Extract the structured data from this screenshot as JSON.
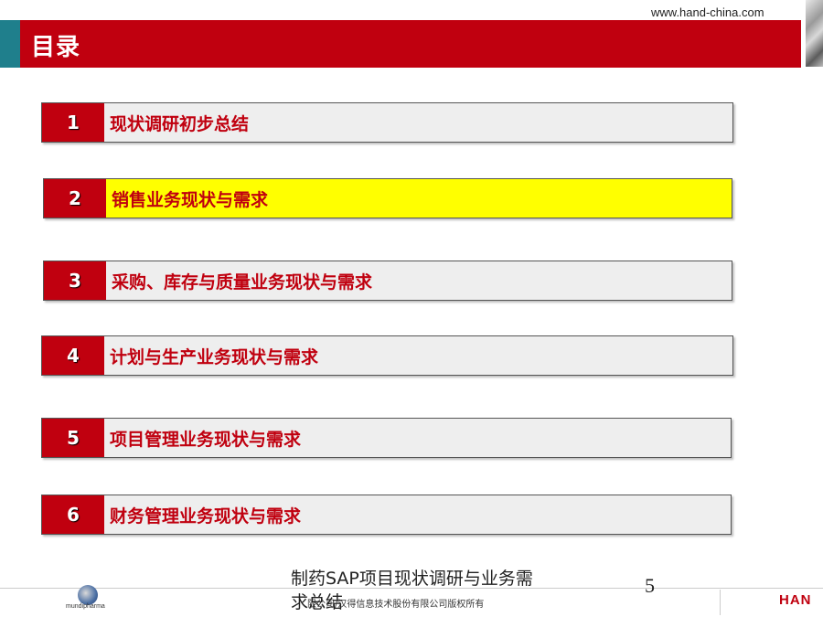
{
  "header": {
    "website": "www.hand-china.com",
    "title": "目录"
  },
  "toc": [
    {
      "number": "1",
      "label": "现状调研初步总结",
      "highlighted": false
    },
    {
      "number": "2",
      "label": "销售业务现状与需求",
      "highlighted": true
    },
    {
      "number": "3",
      "label": "采购、库存与质量业务现状与需求",
      "highlighted": false
    },
    {
      "number": "4",
      "label": "计划与生产业务现状与需求",
      "highlighted": false
    },
    {
      "number": "5",
      "label": "项目管理业务现状与需求",
      "highlighted": false
    },
    {
      "number": "6",
      "label": "财务管理业务现状与需求",
      "highlighted": false
    }
  ],
  "footer": {
    "left_logo_text": "mundipharma",
    "copyright": "限公司/汉得信息技术股份有限公司版权所有",
    "right_logo_text": "HAN",
    "caption": "制药SAP项目现状调研与业务需求总结",
    "page_number": "5"
  },
  "colors": {
    "brand_red": "#c0000f",
    "accent_teal": "#1f7f8c",
    "highlight_yellow": "#ffff00",
    "item_gray": "#eeeeee"
  }
}
